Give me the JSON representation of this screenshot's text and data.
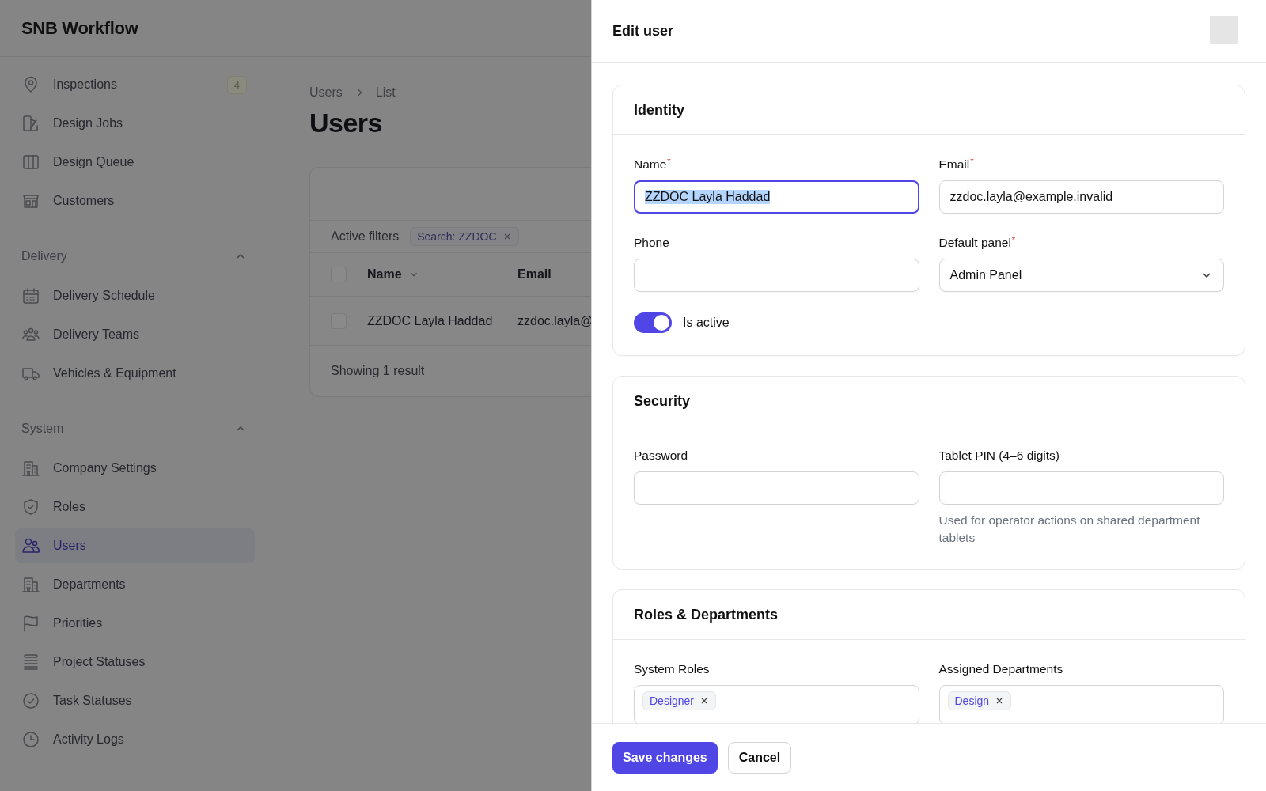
{
  "app": {
    "title": "SNB Workflow"
  },
  "sidebar": {
    "sections": [
      {
        "items": [
          {
            "label": "Inspections",
            "selected": false,
            "badge": "4"
          },
          {
            "label": "Design Jobs",
            "selected": false
          },
          {
            "label": "Design Queue",
            "selected": false
          },
          {
            "label": "Customers",
            "selected": false
          }
        ]
      },
      {
        "label": "Delivery",
        "expanded": true,
        "items": [
          {
            "label": "Delivery Schedule",
            "selected": false
          },
          {
            "label": "Delivery Teams",
            "selected": false
          },
          {
            "label": "Vehicles & Equipment",
            "selected": false
          }
        ]
      },
      {
        "label": "System",
        "expanded": true,
        "items": [
          {
            "label": "Company Settings",
            "selected": false
          },
          {
            "label": "Roles",
            "selected": false
          },
          {
            "label": "Users",
            "selected": true
          },
          {
            "label": "Departments",
            "selected": false
          },
          {
            "label": "Priorities",
            "selected": false
          },
          {
            "label": "Project Statuses",
            "selected": false
          },
          {
            "label": "Task Statuses",
            "selected": false
          },
          {
            "label": "Activity Logs",
            "selected": false
          }
        ]
      }
    ]
  },
  "main": {
    "breadcrumbs": [
      "Users",
      "List"
    ],
    "heading": "Users",
    "table": {
      "active_filters_label": "Active filters",
      "filters": [
        {
          "label": "Search: ZZDOC"
        }
      ],
      "header_checked": false,
      "columns": [
        {
          "label": "Name",
          "sortable": true
        },
        {
          "label": "Email",
          "sortable": false
        }
      ],
      "rows": [
        {
          "checked": false,
          "cells": [
            "ZZDOC Layla Haddad",
            "zzdoc.layla@"
          ]
        }
      ],
      "footer": "Showing 1 result"
    }
  },
  "drawer": {
    "title": "Edit user",
    "sections": [
      {
        "title": "Identity",
        "fields": [
          {
            "kind": "text",
            "label": "Name",
            "required_mark": "*",
            "value": "ZZDOC Layla Haddad",
            "focused": true,
            "value_selected": true
          },
          {
            "kind": "text",
            "label": "Email",
            "required_mark": "*",
            "value": "zzdoc.layla@example.invalid",
            "focused": false
          },
          {
            "kind": "text",
            "label": "Phone",
            "focused": false
          },
          {
            "kind": "select",
            "label": "Default panel",
            "required_mark": "*",
            "value": "Admin Panel"
          },
          {
            "kind": "toggle",
            "label": "Is active",
            "on": true
          }
        ]
      },
      {
        "title": "Security",
        "fields": [
          {
            "kind": "password",
            "label": "Password",
            "focused": false
          },
          {
            "kind": "text",
            "label": "Tablet PIN (4–6 digits)",
            "focused": false,
            "hint": "Used for operator actions on shared department tablets"
          }
        ]
      },
      {
        "title": "Roles & Departments",
        "fields": [
          {
            "kind": "tags",
            "label": "System Roles",
            "tags": [
              {
                "label": "Designer"
              }
            ]
          },
          {
            "kind": "tags",
            "label": "Assigned Departments",
            "tags": [
              {
                "label": "Design"
              }
            ]
          }
        ]
      }
    ],
    "buttons": [
      {
        "label": "Save changes",
        "kind": "primary"
      },
      {
        "label": "Cancel",
        "kind": "secondary"
      }
    ]
  }
}
